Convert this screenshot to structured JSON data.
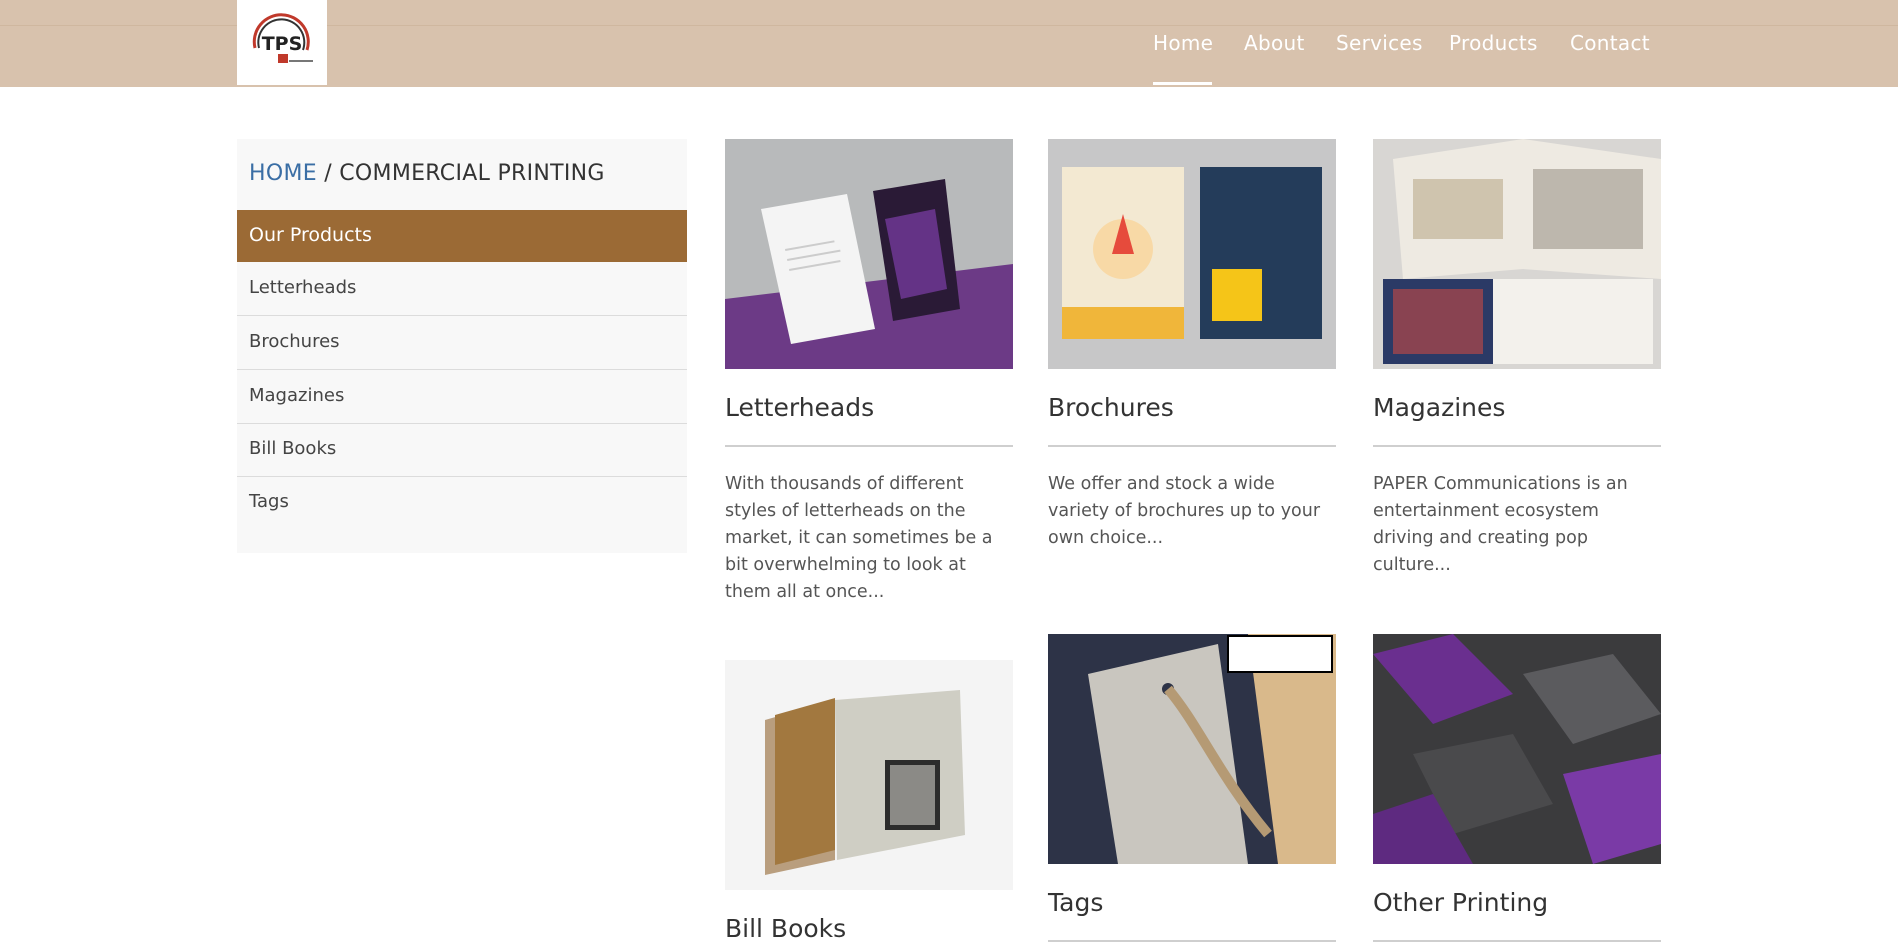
{
  "header": {
    "logo_text": "TPS",
    "nav": [
      {
        "label": "Home",
        "active": true
      },
      {
        "label": "About"
      },
      {
        "label": "Services"
      },
      {
        "label": "Products"
      },
      {
        "label": "Contact"
      }
    ]
  },
  "breadcrumb": {
    "home": "HOME",
    "separator": " / ",
    "current": "COMMERCIAL PRINTING"
  },
  "sidebar": {
    "heading": "Our Products",
    "items": [
      {
        "label": "Letterheads"
      },
      {
        "label": "Brochures"
      },
      {
        "label": "Magazines"
      },
      {
        "label": "Bill Books"
      },
      {
        "label": "Tags"
      }
    ]
  },
  "products": [
    {
      "title": "Letterheads",
      "text": "With thousands of different styles of letterheads on the market, it can sometimes be a bit overwhelming to look at them all at once..."
    },
    {
      "title": "Brochures",
      "text": "We offer and stock a wide variety of brochures up to your own choice..."
    },
    {
      "title": "Magazines",
      "text": "PAPER Communications is an entertainment ecosystem driving and creating pop culture..."
    },
    {
      "title": "Bill Books",
      "text": ""
    },
    {
      "title": "Tags",
      "text": ""
    },
    {
      "title": "Other Printing",
      "text": ""
    }
  ],
  "colors": {
    "header_bg": "#d8c2ad",
    "sidebar_heading_bg": "#9b6a35",
    "breadcrumb_link": "#3a6ea5"
  }
}
